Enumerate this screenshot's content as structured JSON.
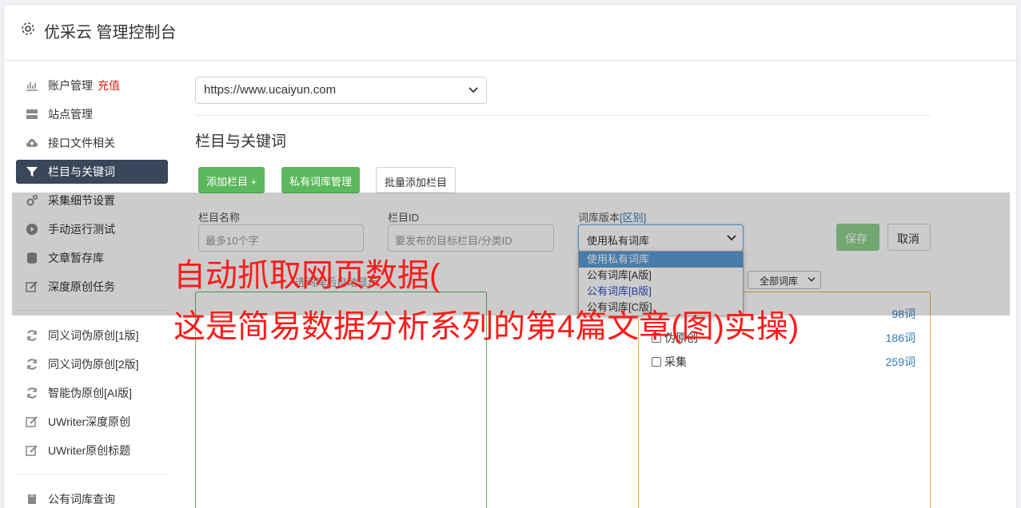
{
  "header": {
    "title": "优采云 管理控制台",
    "icon": "gear-icon"
  },
  "sidebar": {
    "items": [
      {
        "label": "账户管理",
        "extra": "充值",
        "icon": "bar-chart-icon"
      },
      {
        "label": "站点管理",
        "icon": "server-icon"
      },
      {
        "label": "接口文件相关",
        "icon": "cloud-upload-icon"
      },
      {
        "label": "栏目与关键词",
        "icon": "filter-icon",
        "active": true
      },
      {
        "label": "采集细节设置",
        "icon": "cogs-icon"
      },
      {
        "label": "手动运行测试",
        "icon": "play-circle-icon"
      },
      {
        "label": "文章暂存库",
        "icon": "database-icon"
      },
      {
        "label": "深度原创任务",
        "icon": "edit-icon"
      },
      {
        "label": "同义词伪原创[1版]",
        "icon": "refresh-icon"
      },
      {
        "label": "同义词伪原创[2版]",
        "icon": "refresh-icon"
      },
      {
        "label": "智能伪原创[AI版]",
        "icon": "refresh-icon"
      },
      {
        "label": "UWriter深度原创",
        "icon": "edit-icon"
      },
      {
        "label": "UWriter原创标题",
        "icon": "edit-icon"
      },
      {
        "label": "公有词库查询",
        "icon": "book-icon"
      }
    ]
  },
  "main": {
    "site_select": "https://www.ucaiyun.com",
    "section_title": "栏目与关键词",
    "buttons": {
      "add_column": "添加栏目 +",
      "private_lib": "私有词库管理",
      "batch_add": "批量添加栏目"
    },
    "form": {
      "name_label": "栏目名称",
      "name_placeholder": "最多10个字",
      "id_label": "栏目ID",
      "id_placeholder": "要发布的目标栏目/分类ID",
      "lib_label": "词库版本",
      "lib_label_link": "[区别]",
      "lib_value": "使用私有词库",
      "lib_options": [
        "使用私有词库",
        "公有词库[A版]",
        "公有词库[B版]",
        "公有词库[C版]"
      ],
      "save": "保存",
      "cancel": "取消"
    },
    "hint": "选词库后自动显示",
    "lib_filter": "全部词库",
    "lib_list": [
      {
        "name": "",
        "count": "98词"
      },
      {
        "name": "伪原创",
        "count": "186词"
      },
      {
        "name": "采集",
        "count": "259词"
      }
    ]
  },
  "caption": {
    "line1": "自动抓取网页数据(",
    "line2": "这是简易数据分析系列的第4篇文章(图)实操)"
  }
}
